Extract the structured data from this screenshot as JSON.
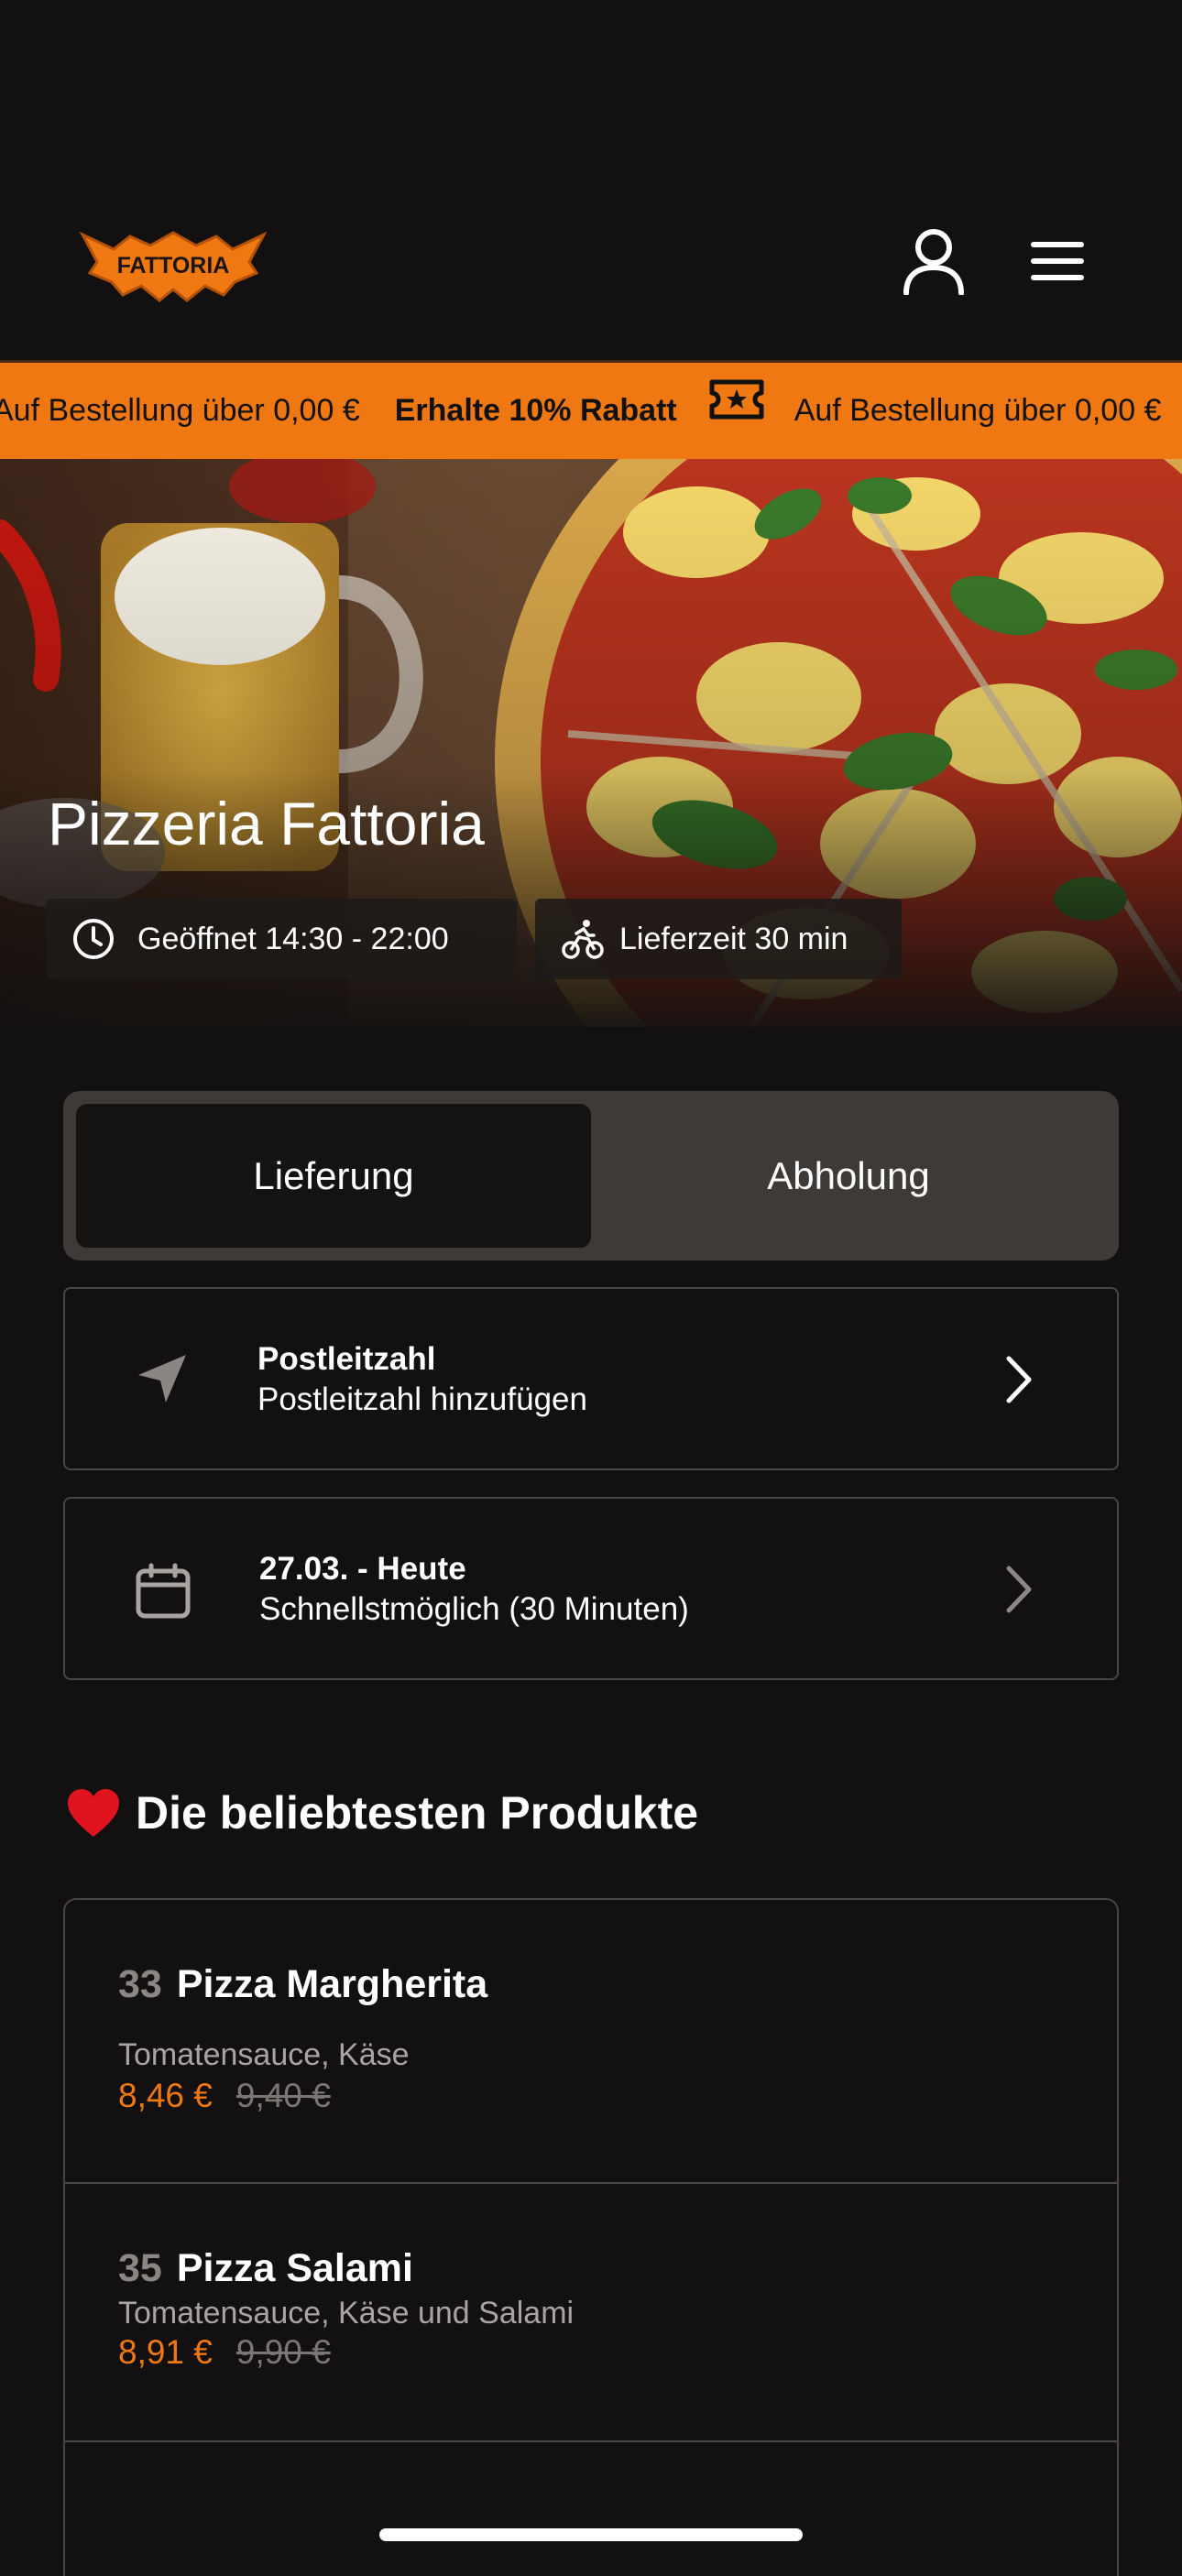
{
  "brand": {
    "logo_text": "FATTORIA",
    "accent": "#ef7812",
    "background": "#121010"
  },
  "header": {
    "icons": [
      "user-icon",
      "menu-icon"
    ]
  },
  "promo": {
    "text_start": "Auf Bestellung über 0,00 €",
    "bold": "Erhalte 10% Rabatt",
    "text_repeat": "Auf Bestellung über 0,00 €",
    "icon": "ticket-icon"
  },
  "hero": {
    "title": "Pizzeria Fattoria",
    "hours": "Geöffnet 14:30 - 22:00",
    "delivery_time": "Lieferzeit 30 min"
  },
  "order_mode": {
    "options": [
      "Lieferung",
      "Abholung"
    ],
    "selected": "Lieferung"
  },
  "postcode": {
    "title": "Postleitzahl",
    "subtitle": "Postleitzahl hinzufügen",
    "icon": "location-arrow-icon"
  },
  "schedule": {
    "title": "27.03. - Heute",
    "subtitle": "Schnellstmöglich (30 Minuten)",
    "icon": "calendar-icon"
  },
  "popular": {
    "heading_emoji": "❤️",
    "heading": "Die beliebtesten Produkte",
    "items": [
      {
        "number": "33",
        "name": "Pizza Margherita",
        "description": "Tomatensauce, Käse",
        "price": "8,46 €",
        "old_price": "9,40 €"
      },
      {
        "number": "35",
        "name": "Pizza Salami",
        "description": "Tomatensauce, Käse und Salami",
        "price": "8,91 €",
        "old_price": "9,90 €"
      }
    ]
  }
}
